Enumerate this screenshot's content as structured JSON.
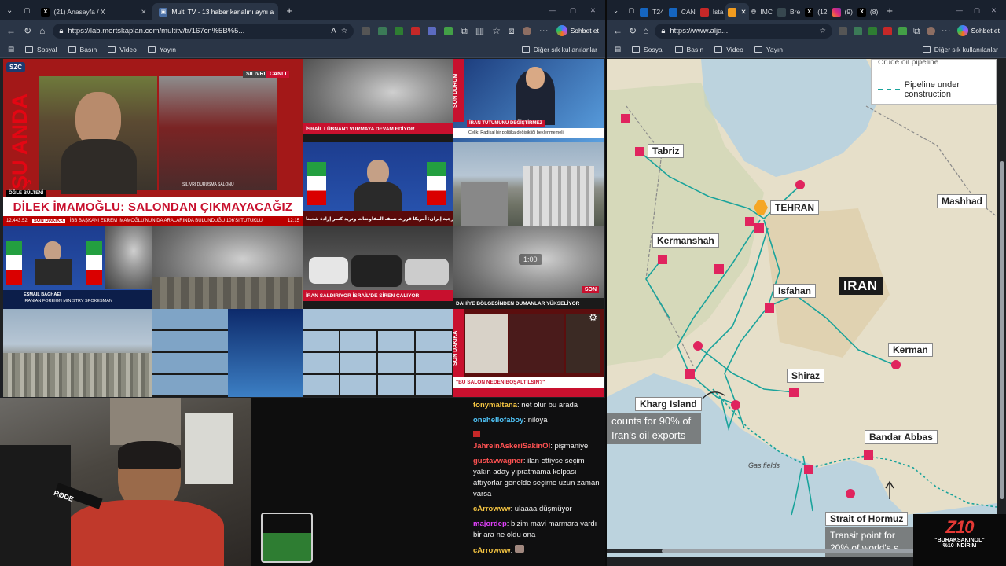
{
  "left_window": {
    "tabs": [
      {
        "icon": "x-logo-icon",
        "title": "(21) Anasayfa / X",
        "active": false
      },
      {
        "icon": "tv-icon",
        "title": "Multi TV - 13 haber kanalını aynı a",
        "active": true
      }
    ],
    "url": "https://lab.mertskaplan.com/multitv/tr/167cn%5B%5...",
    "copilot_label": "Sohbet et",
    "bookmarks": [
      "Sosyal",
      "Basın",
      "Video",
      "Yayın"
    ],
    "bookmarks_other": "Diğer sık kullanılanlar",
    "streams": {
      "szc": {
        "logo": "SZC",
        "badge_live": "SILIVRI",
        "badge_canli": "CANLI",
        "vertical": "ŞU ANDA",
        "bulletin": "ÖĞLE BÜLTENİ",
        "headline": "DİLEK İMAMOĞLU: SALONDAN ÇIKMAYACAĞIZ",
        "viewers": "12.443,52",
        "ticker": "İBB BAŞKANI EKREM İMAMOĞLU'NUN DA ARALARINDA BULUNDUĞU 106'SI TUTUKLU",
        "ticker_tag": "SON DAKİKA",
        "clock": "12:15",
        "caption": "SİLİVRİ DURUŞMA SALONU"
      },
      "haberturk": {
        "bar": "İSRAİL LÜBNAN'I VURMAYA DEVAM EDİYOR"
      },
      "sondurum": {
        "side": "SON DURUM",
        "bar": "İRAN TUTUMUNU DEĞİŞTİRMEZ",
        "sub": "Çelik: Radikal bir politika değişikliği beklenmemeli"
      },
      "iran_tv": {
        "bar": "خارجية إيران: أمريكا قررت نسف المفاوضات وتريد كسر إرادة شعبنا"
      },
      "iran_tv2": {
        "name": "ESMAIL BAGHAEI",
        "role": "IRANIAN FOREIGN MINISTRY SPOKESMAN"
      },
      "traffic": {
        "bar": "İRAN SALDIRIYOR İSRAİL'DE SİREN ÇALIYOR"
      },
      "dahiye": {
        "timer": "1:00",
        "bar": "DAHİYE BÖLGESİNDEN DUMANLAR YÜKSELİYOR",
        "logo": "SON"
      },
      "sondakika": {
        "side": "SON DAKİKA",
        "bar": "\"BU SALON NEDEN BOŞALTILSIN?\""
      }
    }
  },
  "chat": {
    "messages": [
      {
        "user": "tonymaltana",
        "text": "net olur bu arada",
        "color": "#f5c542"
      },
      {
        "user": "onehellofaboy",
        "text": "niloya",
        "color": "#4fc3f7"
      },
      {
        "user": "JahreinAskeriSakinOl",
        "text": "pişmaniye",
        "color": "#ff5252"
      },
      {
        "user": "gustavwagner",
        "text": "ilan ettiyse seçim yakın aday yıpratmama kolpası attıyorlar genelde seçime uzun zaman varsa",
        "color": "#ff5252"
      },
      {
        "user": "cArrowww",
        "text": "ulaaaa düşmüyor",
        "color": "#f5c542"
      },
      {
        "user": "majordep",
        "text": "bizim mavi marmara vardı bir ara ne oldu ona",
        "color": "#e040fb"
      },
      {
        "user": "cArrowww",
        "text": "",
        "color": "#f5c542"
      }
    ]
  },
  "webcam": {
    "mic_brand": "RØDE"
  },
  "right_window": {
    "tabs": [
      {
        "icon": "tab-icon",
        "title": "T24"
      },
      {
        "icon": "tab-icon",
        "title": "CAN"
      },
      {
        "icon": "tab-icon",
        "title": "İsta"
      },
      {
        "icon": "globe-icon",
        "title": "IMC"
      },
      {
        "icon": "tab-icon",
        "title": "Bre"
      },
      {
        "icon": "x-logo-icon",
        "title": "(12"
      },
      {
        "icon": "instagram-icon",
        "title": "(9)"
      },
      {
        "icon": "x-logo-icon",
        "title": "(8)"
      }
    ],
    "url": "https://www.alja...",
    "copilot_label": "Sohbet et",
    "bookmarks": [
      "Sosyal",
      "Basın",
      "Video",
      "Yayın"
    ],
    "bookmarks_other": "Diğer sık kullanılanlar"
  },
  "map": {
    "legend_top": "Crude oil pipeline",
    "legend_item": "Pipeline under construction",
    "country": "IRAN",
    "cities": {
      "tabriz": "Tabriz",
      "tehran": "TEHRAN",
      "mashhad": "Mashhad",
      "kermanshah": "Kermanshah",
      "isfahan": "Isfahan",
      "kerman": "Kerman",
      "shiraz": "Shiraz",
      "kharg": "Kharg Island",
      "bandar": "Bandar Abbas",
      "hormuz": "Strait of Hormuz"
    },
    "kharg_callout": "counts for 90% of Iran's oil exports",
    "hormuz_callout": "Transit point for 20% of world's s",
    "gas_fields": "Gas fields",
    "colors": {
      "pipeline": "#1aa39b",
      "marker": "#e0245e",
      "land": "#e8e2cf",
      "sea": "#bcd3de"
    }
  },
  "promo": {
    "logo": "Z10",
    "line1": "\"BURAKSAKINOL\"",
    "line2": "%10 İNDİRİM"
  }
}
